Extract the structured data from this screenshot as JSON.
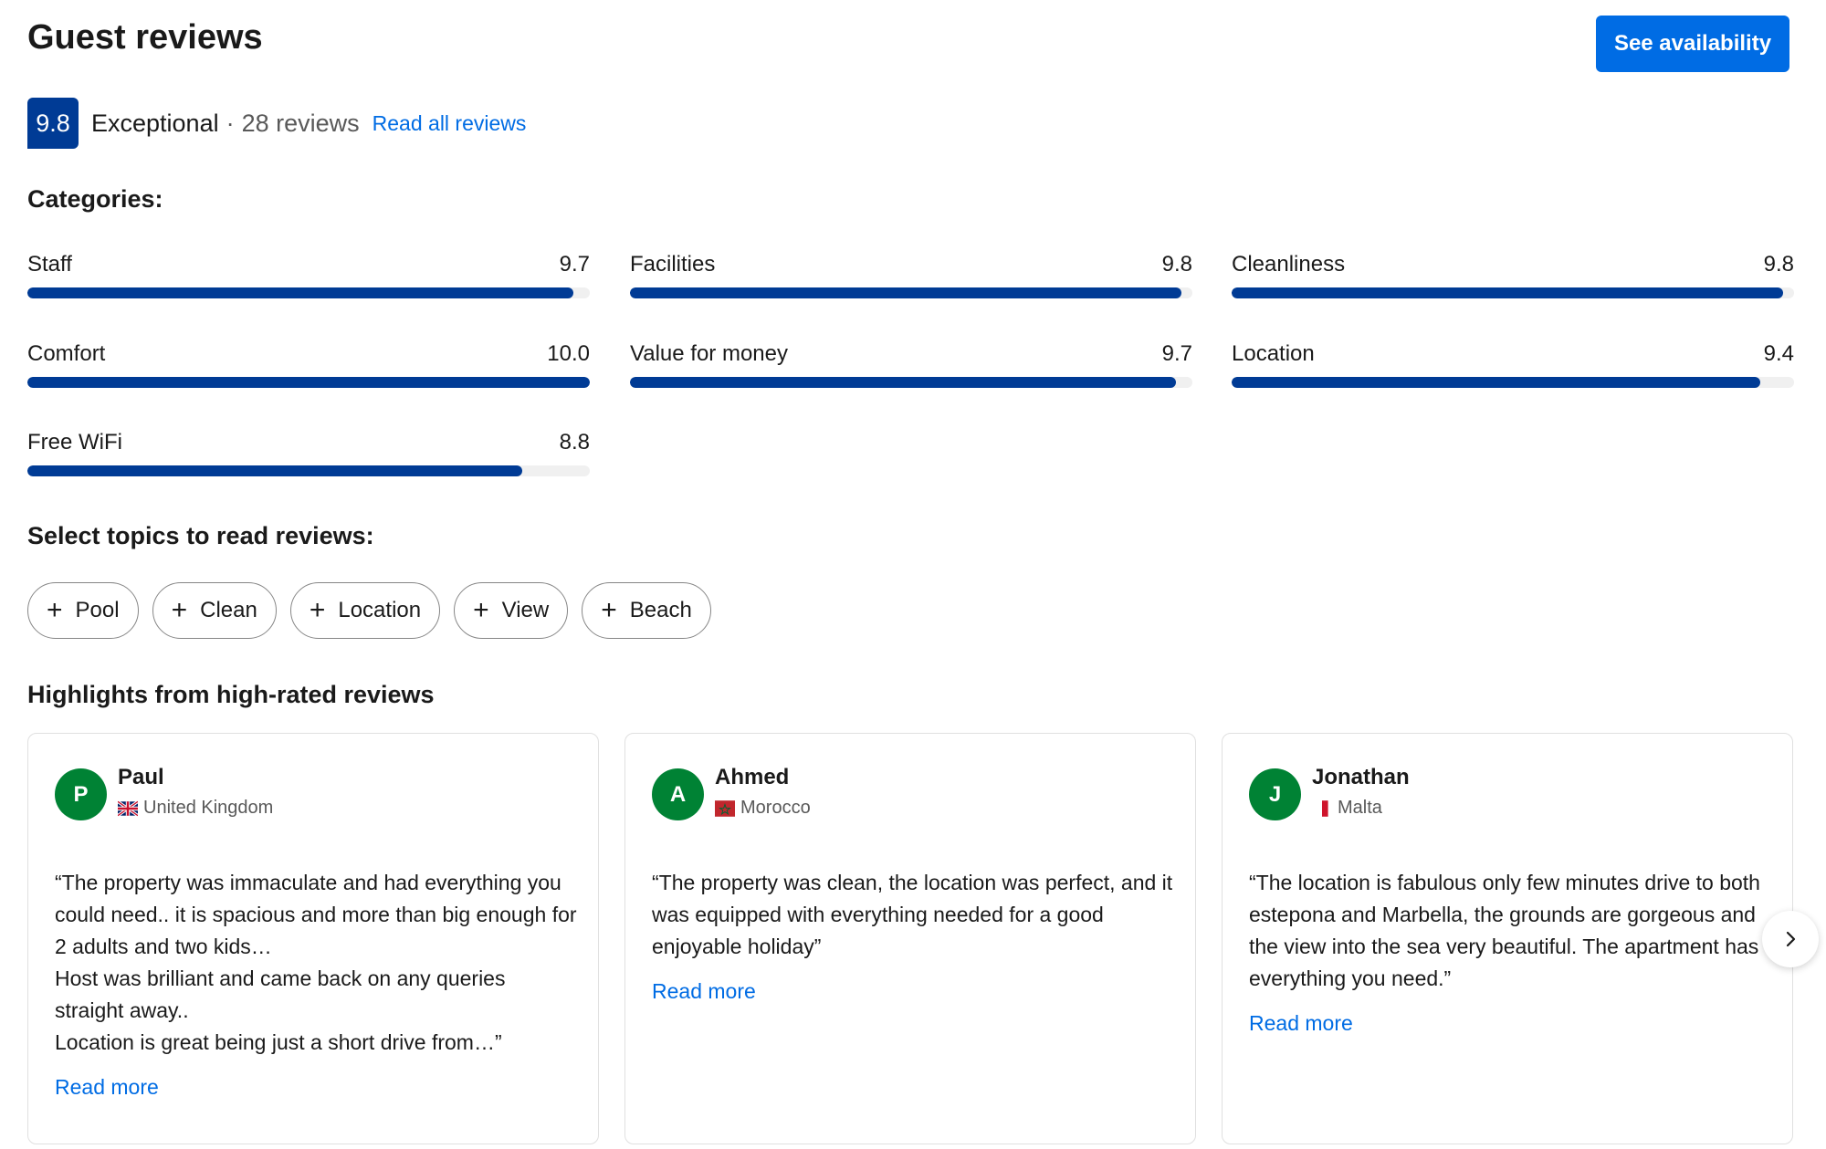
{
  "header": {
    "title": "Guest reviews",
    "cta_label": "See availability"
  },
  "score": {
    "value": "9.8",
    "word": "Exceptional",
    "separator": "·",
    "count": "28 reviews",
    "read_all": "Read all reviews"
  },
  "categories": {
    "heading": "Categories:",
    "items": [
      {
        "label": "Staff",
        "score": "9.7",
        "fraction": 0.97
      },
      {
        "label": "Facilities",
        "score": "9.8",
        "fraction": 0.98
      },
      {
        "label": "Cleanliness",
        "score": "9.8",
        "fraction": 0.98
      },
      {
        "label": "Comfort",
        "score": "10.0",
        "fraction": 1.0
      },
      {
        "label": "Value for money",
        "score": "9.7",
        "fraction": 0.97
      },
      {
        "label": "Location",
        "score": "9.4",
        "fraction": 0.94
      },
      {
        "label": "Free WiFi",
        "score": "8.8",
        "fraction": 0.88
      }
    ]
  },
  "topics": {
    "heading": "Select topics to read reviews:",
    "plus_symbol": "+",
    "chips": [
      "Pool",
      "Clean",
      "Location",
      "View",
      "Beach"
    ]
  },
  "highlights": {
    "heading": "Highlights from high-rated reviews",
    "reviews": [
      {
        "initial": "P",
        "name": "Paul",
        "country": "United Kingdom",
        "flag_icon": "uk-flag-icon",
        "text": "“The property was immaculate and had everything you could need.. it is spacious and more than big enough for 2 adults and two kids…\nHost was brilliant and came back on any queries straight away..\nLocation is great being just a short drive from…”",
        "read_more": "Read more"
      },
      {
        "initial": "A",
        "name": "Ahmed",
        "country": "Morocco",
        "flag_icon": "morocco-flag-icon",
        "text": "“The property was clean, the location was perfect, and it was equipped with everything needed for a good enjoyable holiday”",
        "read_more": "Read more"
      },
      {
        "initial": "J",
        "name": "Jonathan",
        "country": "Malta",
        "flag_icon": "malta-flag-icon",
        "text": "“The location is fabulous only few minutes drive to both estepona and Marbella, the grounds are gorgeous and the view into the sea very beautiful. The apartment has everything you need.”",
        "read_more": "Read more"
      }
    ],
    "next_icon": "chevron-right-icon"
  },
  "colors": {
    "brand_blue": "#003b95",
    "action_blue": "#006ce4",
    "avatar_green": "#008234"
  }
}
